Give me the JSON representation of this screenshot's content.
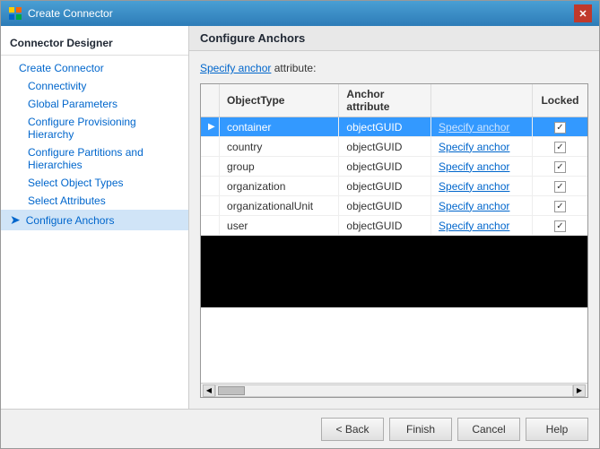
{
  "window": {
    "title": "Create Connector",
    "close_label": "✕"
  },
  "sidebar": {
    "header": "Connector Designer",
    "items": [
      {
        "id": "create-connector",
        "label": "Create Connector",
        "indent": false,
        "active": false
      },
      {
        "id": "connectivity",
        "label": "Connectivity",
        "indent": true,
        "active": false
      },
      {
        "id": "global-parameters",
        "label": "Global Parameters",
        "indent": true,
        "active": false
      },
      {
        "id": "configure-provisioning",
        "label": "Configure Provisioning Hierarchy",
        "indent": true,
        "active": false
      },
      {
        "id": "configure-partitions",
        "label": "Configure Partitions and Hierarchies",
        "indent": true,
        "active": false
      },
      {
        "id": "select-object-types",
        "label": "Select Object Types",
        "indent": true,
        "active": false
      },
      {
        "id": "select-attributes",
        "label": "Select Attributes",
        "indent": true,
        "active": false
      },
      {
        "id": "configure-anchors",
        "label": "Configure Anchors",
        "indent": false,
        "active": true,
        "arrow": true
      }
    ]
  },
  "main": {
    "header": "Configure Anchors",
    "specify_anchor_label": "Specify anchor",
    "specify_anchor_suffix": " attribute:",
    "table": {
      "columns": [
        {
          "id": "arrow",
          "label": ""
        },
        {
          "id": "object-type",
          "label": "ObjectType"
        },
        {
          "id": "anchor-attribute",
          "label": "Anchor attribute"
        },
        {
          "id": "specify",
          "label": ""
        },
        {
          "id": "locked",
          "label": "Locked"
        }
      ],
      "rows": [
        {
          "selected": true,
          "object_type": "container",
          "anchor_attribute": "objectGUID",
          "specify_label": "Specify anchor",
          "locked": true
        },
        {
          "selected": false,
          "object_type": "country",
          "anchor_attribute": "objectGUID",
          "specify_label": "Specify anchor",
          "locked": true
        },
        {
          "selected": false,
          "object_type": "group",
          "anchor_attribute": "objectGUID",
          "specify_label": "Specify anchor",
          "locked": true
        },
        {
          "selected": false,
          "object_type": "organization",
          "anchor_attribute": "objectGUID",
          "specify_label": "Specify anchor",
          "locked": true
        },
        {
          "selected": false,
          "object_type": "organizationalUnit",
          "anchor_attribute": "objectGUID",
          "specify_label": "Specify anchor",
          "locked": true
        },
        {
          "selected": false,
          "object_type": "user",
          "anchor_attribute": "objectGUID",
          "specify_label": "Specify anchor",
          "locked": true
        }
      ]
    }
  },
  "buttons": {
    "back": "< Back",
    "finish": "Finish",
    "cancel": "Cancel",
    "help": "Help"
  }
}
